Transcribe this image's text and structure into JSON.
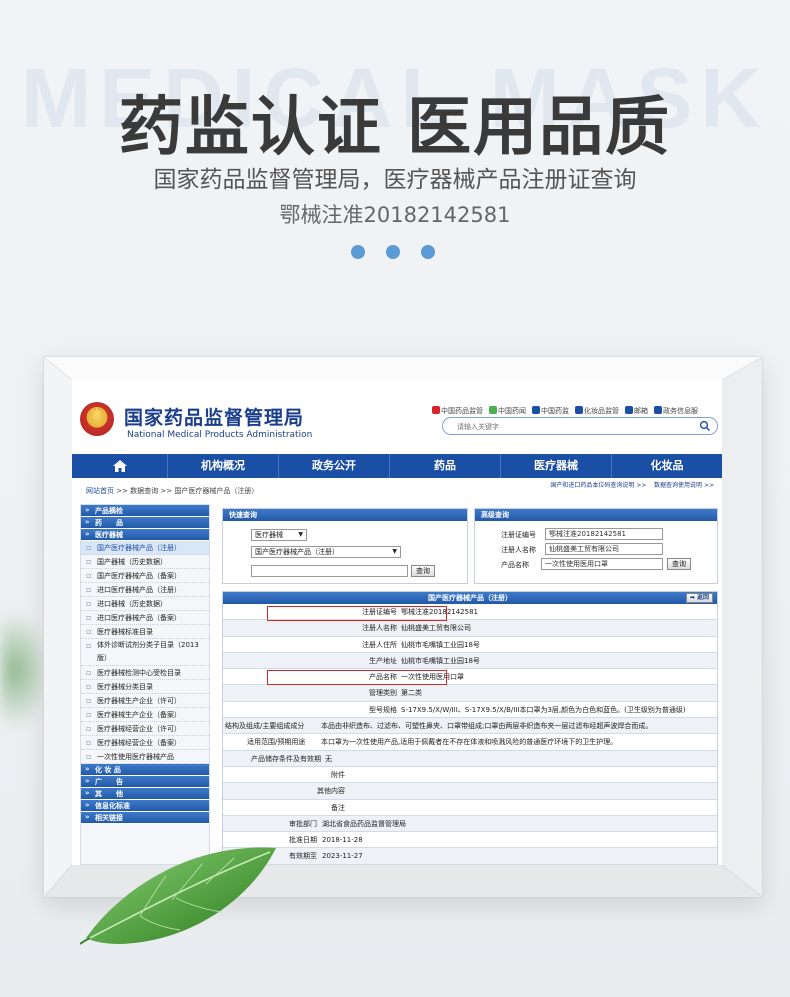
{
  "hero": {
    "watermark": "MEDICAL MASK",
    "title": "药监认证 医用品质",
    "subtitle": "国家药品监督管理局，医疗器械产品注册证查询",
    "cert": "鄂械注准20182142581"
  },
  "site": {
    "name_cn": "国家药品监督管理局",
    "name_en": "National Medical Products Administration",
    "top_links": [
      "中国药品监管",
      "中国药闻",
      "中国药监",
      "化妆品监管",
      "邮箱",
      "政务信息服"
    ],
    "search_placeholder": "请输入关键字"
  },
  "nav": [
    "机构概况",
    "政务公开",
    "药品",
    "医疗器械",
    "化妆品"
  ],
  "breadcrumb": {
    "home": "网站首页",
    "path": " >> 数据查询 >> 国产医疗器械产品（注册）",
    "right_link1": "国产和进口药品本位码查询说明 >>",
    "right_link2": "数据查询使用说明 >>"
  },
  "sidebar": {
    "sections": [
      {
        "head": "产品摘检",
        "items": []
      },
      {
        "head": "药　　品",
        "items": []
      },
      {
        "head": "医疗器械",
        "items": [
          {
            "label": "国产医疗器械产品（注册）",
            "selected": true
          },
          {
            "label": "国产器械（历史数据）"
          },
          {
            "label": "国产医疗器械产品（备案）"
          },
          {
            "label": "进口医疗器械产品（注册）"
          },
          {
            "label": "进口器械（历史数据）"
          },
          {
            "label": "进口医疗器械产品（备案）"
          },
          {
            "label": "医疗器械标准目录"
          },
          {
            "label": "体外诊断试剂分类子目录（2013版）",
            "tall": true
          },
          {
            "label": "医疗器械检测中心受检目录"
          },
          {
            "label": "医疗器械分类目录"
          },
          {
            "label": "医疗器械生产企业（许可）"
          },
          {
            "label": "医疗器械生产企业（备案）"
          },
          {
            "label": "医疗器械经营企业（许可）"
          },
          {
            "label": "医疗器械经营企业（备案）"
          },
          {
            "label": "一次性使用医疗器械产品"
          }
        ]
      },
      {
        "head": "化 妆 品",
        "items": []
      },
      {
        "head": "广　　告",
        "items": []
      },
      {
        "head": "其　　他",
        "items": []
      },
      {
        "head": "信息化标准",
        "items": []
      },
      {
        "head": "相关链接",
        "items": []
      }
    ]
  },
  "quick": {
    "head": "快速查询",
    "select1": "医疗器械",
    "select2": "国产医疗器械产品（注册）",
    "button": "查询"
  },
  "advanced": {
    "head": "高级查询",
    "f1_label": "注册证编号",
    "f1_value": "鄂械注准20182142581",
    "f2_label": "注册人名称",
    "f2_value": "仙桃盛美工贸有限公司",
    "f3_label": "产品名称",
    "f3_value": "一次性使用医用口罩",
    "button": "查询"
  },
  "result": {
    "head": "国产医疗器械产品（注册）",
    "back": "返回",
    "rows": [
      {
        "k": "注册证编号",
        "v": "鄂械注准20182142581"
      },
      {
        "k": "注册人名称",
        "v": "仙桃盛美工贸有限公司"
      },
      {
        "k": "注册人住所",
        "v": "仙桃市毛嘴镇工业园18号"
      },
      {
        "k": "生产地址",
        "v": "仙桃市毛嘴镇工业园18号"
      },
      {
        "k": "产品名称",
        "v": "一次性使用医用口罩"
      },
      {
        "k": "管理类别",
        "v": "第二类"
      },
      {
        "k": "型号规格",
        "v": "S-17X9.5/X/W/III、S-17X9.5/X/B/III本口罩为3层,颜色为白色和蓝色。(卫生级别为普通级)"
      },
      {
        "k": "结构及组成/主要组成成分",
        "v": "本品由非织造布、过滤布、可塑性鼻夹、口罩带组成;口罩由两层非织造布夹一层过滤布经超声波焊合而成。"
      },
      {
        "k": "适用范围/预期用途",
        "v": "本口罩为一次性使用产品,适用于佩戴者在不存在体液和喷溅风险的普通医疗环境下的卫生护理。"
      },
      {
        "k": "产品储存条件及有效期",
        "v": "无"
      },
      {
        "k": "附件",
        "v": ""
      },
      {
        "k": "其他内容",
        "v": ""
      },
      {
        "k": "备注",
        "v": ""
      },
      {
        "k": "审批部门",
        "v": "湖北省食品药品监督管理局"
      },
      {
        "k": "批准日期",
        "v": "2018-11-28"
      },
      {
        "k": "有效期至",
        "v": "2023-11-27"
      }
    ]
  }
}
